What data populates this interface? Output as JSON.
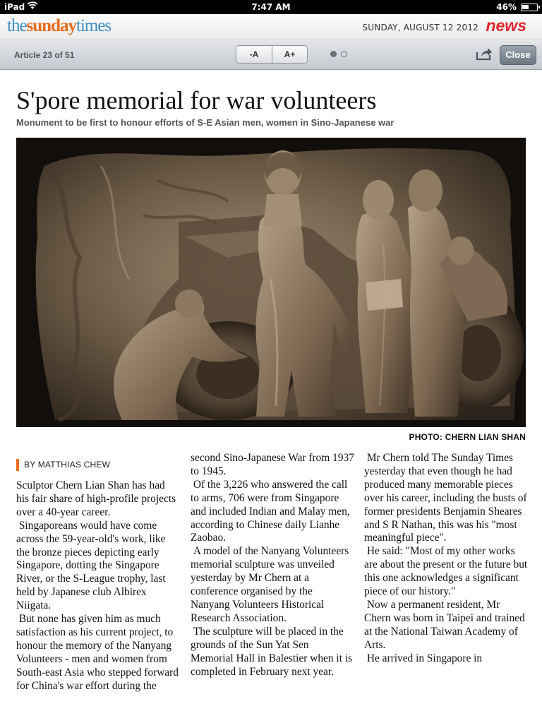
{
  "status_bar": {
    "device": "iPad",
    "time": "7:47 AM",
    "battery": "46%"
  },
  "header": {
    "logo_parts": [
      "the",
      "sunday",
      "times"
    ],
    "date": "SUNDAY, AUGUST 12 2012",
    "section": "news",
    "colors": {
      "logo_blue": "#3f8fc6",
      "logo_orange": "#e86d1f",
      "news_red": "#e0252d"
    }
  },
  "toolbar": {
    "article_count": "Article 23 of 51",
    "font_decrease_label": "-A",
    "font_increase_label": "A+",
    "close_label": "Close",
    "page_indicator": {
      "pages": 2,
      "current": 1
    }
  },
  "article": {
    "headline": "S'pore memorial for war volunteers",
    "standfirst": "Monument to be first to honour efforts of S-E Asian men, women in Sino-Japanese war",
    "photo_credit": "PHOTO: CHERN LIAN SHAN",
    "byline": "BY MATTHIAS CHEW",
    "columns": [
      [
        "Sculptor Chern Lian Shan has had his fair share of high-profile projects over a 40-year career.",
        " Singaporeans would have come across the 59-year-old's work, like the bronze pieces depicting early Singapore, dotting the Singapore River, or the S-League trophy, last held by Japanese club Albirex Niigata.",
        " But none has given him as much satisfaction as his current project, to honour the memory of the Nanyang Volunteers - men and women from South-east Asia who stepped forward for China's war effort during the"
      ],
      [
        "second Sino-Japanese War from 1937 to 1945.",
        " Of the 3,226 who answered the call to arms, 706 were from Singapore and included Indian and Malay men, according to Chinese daily Lianhe Zaobao.",
        " A model of the Nanyang Volunteers memorial sculpture was unveiled yesterday by Mr Chern at a conference organised by the Nanyang Volunteers Historical Research Association.",
        " The sculpture will be placed in the grounds of the Sun Yat Sen Memorial Hall in Balestier when it is completed in February next year."
      ],
      [
        " Mr Chern told The Sunday Times yesterday that even though he had produced many memorable pieces over his career, including the busts of former presidents Benjamin Sheares and S R Nathan, this was his \"most meaningful piece\".",
        " He said: \"Most of my other works are about the present or the future but this one acknowledges a significant piece of our history.\"",
        " Now a permanent resident, Mr Chern was born in Taipei and trained at the National Taiwan Academy of Arts.",
        " He arrived in Singapore in"
      ]
    ]
  }
}
